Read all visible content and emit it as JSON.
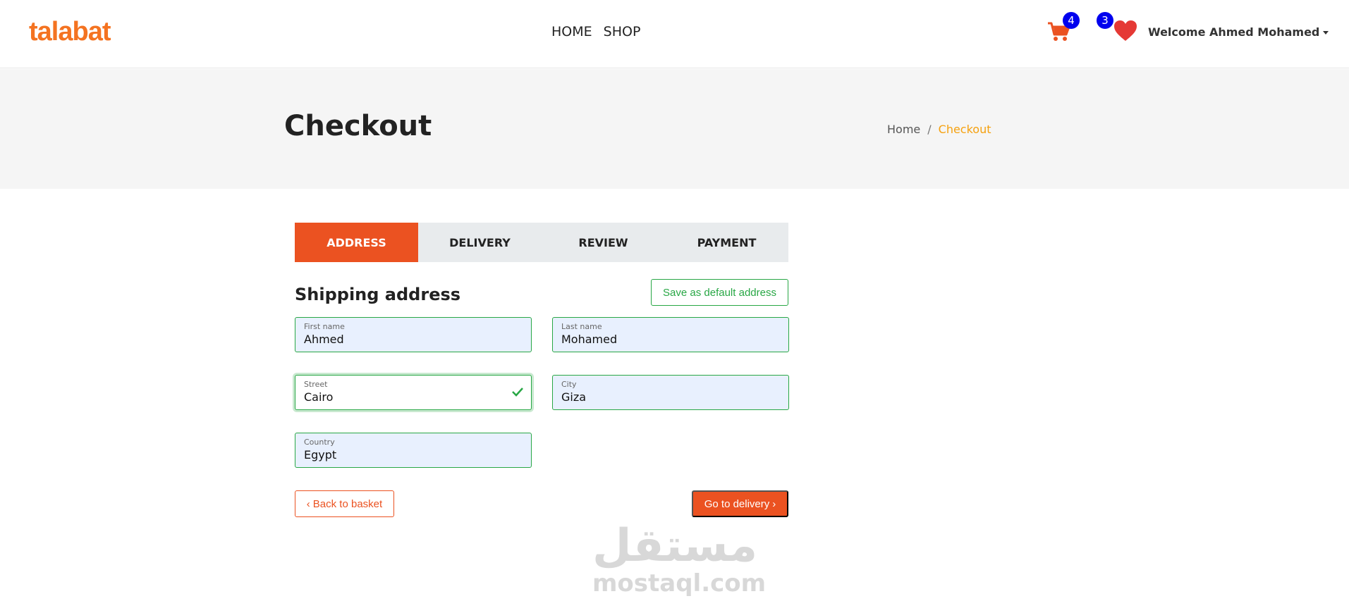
{
  "navbar": {
    "brand": "talabat",
    "links": [
      "HOME",
      "SHOP"
    ],
    "cart_count": "4",
    "wishlist_count": "3",
    "user_greeting": "Welcome Ahmed Mohamed"
  },
  "header": {
    "title": "Checkout",
    "breadcrumb": {
      "home": "Home",
      "separator": "/",
      "current": "Checkout"
    }
  },
  "steps": [
    {
      "label": "ADDRESS",
      "active": true
    },
    {
      "label": "DELIVERY",
      "active": false
    },
    {
      "label": "REVIEW",
      "active": false
    },
    {
      "label": "PAYMENT",
      "active": false
    }
  ],
  "shipping": {
    "title": "Shipping address",
    "save_default_label": "Save as default address",
    "fields": {
      "first_name": {
        "label": "First name",
        "value": "Ahmed"
      },
      "last_name": {
        "label": "Last name",
        "value": "Mohamed"
      },
      "street": {
        "label": "Street",
        "value": "Cairo"
      },
      "city": {
        "label": "City",
        "value": "Giza"
      },
      "country": {
        "label": "Country",
        "value": "Egypt"
      }
    },
    "back_label": "Back to basket",
    "next_label": "Go to delivery"
  },
  "watermark": {
    "arabic": "مستقل",
    "latin": "mostaql.com"
  },
  "colors": {
    "brand": "#f47321",
    "accent": "#eb5221",
    "success": "#28a745",
    "breadcrumb_active": "#f5a10f",
    "badge": "#0000ee"
  }
}
